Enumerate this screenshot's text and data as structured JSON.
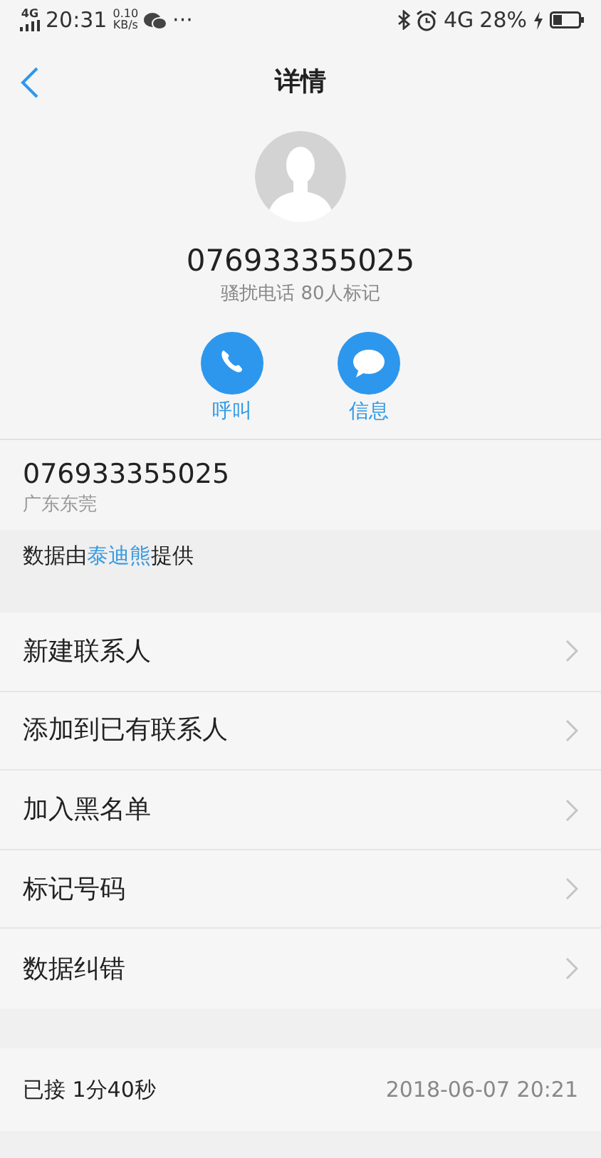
{
  "status_bar": {
    "network": "4G",
    "time": "20:31",
    "speed_value": "0.10",
    "speed_unit": "KB/s",
    "more": "···",
    "network_right": "4G",
    "battery": "28%"
  },
  "header": {
    "title": "详情"
  },
  "contact": {
    "number": "076933355025",
    "tag": "骚扰电话 80人标记"
  },
  "actions": [
    {
      "kind": "call",
      "label": "呼叫"
    },
    {
      "kind": "message",
      "label": "信息"
    }
  ],
  "number_info": {
    "number": "076933355025",
    "location": "广东东莞"
  },
  "provider": {
    "before": "数据由",
    "link": "泰迪熊",
    "after": "提供"
  },
  "menu": [
    {
      "label": "新建联系人"
    },
    {
      "label": "添加到已有联系人"
    },
    {
      "label": "加入黑名单"
    },
    {
      "label": "标记号码"
    },
    {
      "label": "数据纠错"
    }
  ],
  "call_log": {
    "summary": "已接 1分40秒",
    "time": "2018-06-07 20:21"
  }
}
